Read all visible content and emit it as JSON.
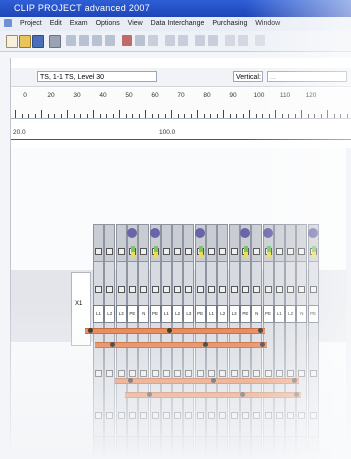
{
  "window": {
    "title": "CLIP PROJECT  advanced 2007"
  },
  "menu": {
    "items": [
      "Project",
      "Edit",
      "Exam",
      "Options",
      "View",
      "Data Interchange",
      "Purchasing",
      "Window"
    ]
  },
  "toolbar": {
    "icons": [
      "new-icon",
      "open-icon",
      "save-icon",
      "print-icon",
      "cut-icon",
      "copy-icon",
      "paste-icon",
      "undo-icon",
      "redo-icon",
      "zoom-icon",
      "grid-icon",
      "insert-icon",
      "align-icon",
      "draw-icon",
      "measure-icon",
      "settings-icon",
      "export-icon",
      "help-icon"
    ]
  },
  "subtoolbar": {
    "rail_select": "TS, 1-1 TS, Level 30",
    "mode_select": "Vertical: ...",
    "mode_option": "..."
  },
  "ruler": {
    "numbers": [
      "0",
      "20",
      "30",
      "40",
      "50",
      "60",
      "70",
      "80",
      "90",
      "100",
      "110",
      "120"
    ]
  },
  "coords": {
    "left": "20.0",
    "mid": "100.0"
  },
  "terminals": {
    "labels": [
      "L1",
      "L2",
      "L3",
      "PE",
      "N",
      "PE",
      "L1",
      "L2",
      "L3",
      "PE",
      "L1",
      "L2",
      "L3",
      "PE",
      "N",
      "PE",
      "L1",
      "L2",
      "N",
      "PE"
    ],
    "side_label": "X1"
  },
  "colors": {
    "title_bar": "#2f5fd6",
    "bridge": "#e8743a",
    "terminal": "#d7dae0",
    "accent_circle": "#6a64a8"
  }
}
